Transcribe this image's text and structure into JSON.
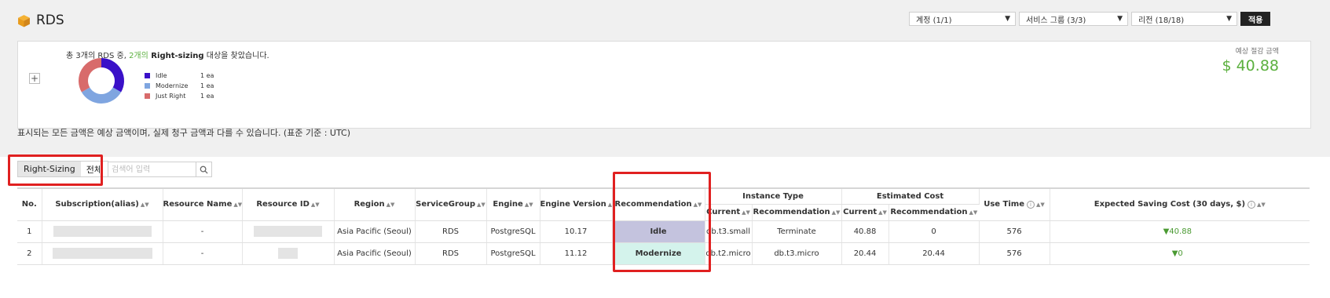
{
  "header": {
    "title": "RDS",
    "filters": [
      {
        "id": "account",
        "value": "계정 (1/1)"
      },
      {
        "id": "service-group",
        "value": "서비스 그룹 (3/3)"
      },
      {
        "id": "region",
        "value": "리전 (18/18)"
      }
    ],
    "apply_label": "적용"
  },
  "summary": {
    "message_pre": "총 3개의 RDS 중, ",
    "message_count": "2개의",
    "message_bold": " Right-sizing",
    "message_post": " 대상을 찾았습니다.",
    "expand_label": "+",
    "monthly_label": "예상 절감 금액",
    "monthly_value": "$ 40.88",
    "legend": [
      {
        "label": "Idle",
        "count": "1 ea",
        "color": "#3a10c8"
      },
      {
        "label": "Modernize",
        "count": "1 ea",
        "color": "#7fa5e0"
      },
      {
        "label": "Just Right",
        "count": "1 ea",
        "color": "#d86b6b"
      }
    ],
    "chart_data": {
      "type": "pie",
      "categories": [
        "Idle",
        "Modernize",
        "Just Right"
      ],
      "values": [
        1,
        1,
        1
      ]
    }
  },
  "notice": "표시되는 모든 금액은 예상 금액이며, 실제 청구 금액과 다를 수 있습니다. (표준 기준 : UTC)",
  "tabs": [
    {
      "label": "Right-Sizing",
      "active": true
    },
    {
      "label": "전체",
      "active": false
    }
  ],
  "search": {
    "placeholder": "검색어 입력"
  },
  "table": {
    "headers": {
      "no": "No.",
      "subscription": "Subscription(alias)",
      "resource_name": "Resource Name",
      "resource_id": "Resource ID",
      "region": "Region",
      "service_group": "ServiceGroup",
      "engine": "Engine",
      "engine_version": "Engine Version",
      "recommendation": "Recommendation",
      "instance_type": "Instance Type",
      "instance_current": "Current",
      "instance_recommendation": "Recommendation",
      "estimated_cost": "Estimated Cost",
      "cost_current": "Current",
      "cost_recommendation": "Recommendation",
      "use_time": "Use Time",
      "expected_saving": "Expected Saving Cost (30 days, $)"
    },
    "rows": [
      {
        "no": "1",
        "resource_name": "-",
        "region": "Asia Pacific (Seoul)",
        "service_group": "RDS",
        "engine": "PostgreSQL",
        "engine_version": "10.17",
        "recommendation": "Idle",
        "instance_current": "db.t3.small",
        "instance_recommendation": "Terminate",
        "cost_current": "40.88",
        "cost_recommendation": "0",
        "use_time": "576",
        "saving": "40.88"
      },
      {
        "no": "2",
        "resource_name": "-",
        "region": "Asia Pacific (Seoul)",
        "service_group": "RDS",
        "engine": "PostgreSQL",
        "engine_version": "11.12",
        "recommendation": "Modernize",
        "instance_current": "db.t2.micro",
        "instance_recommendation": "db.t3.micro",
        "cost_current": "20.44",
        "cost_recommendation": "20.44",
        "use_time": "576",
        "saving": "0"
      }
    ]
  }
}
